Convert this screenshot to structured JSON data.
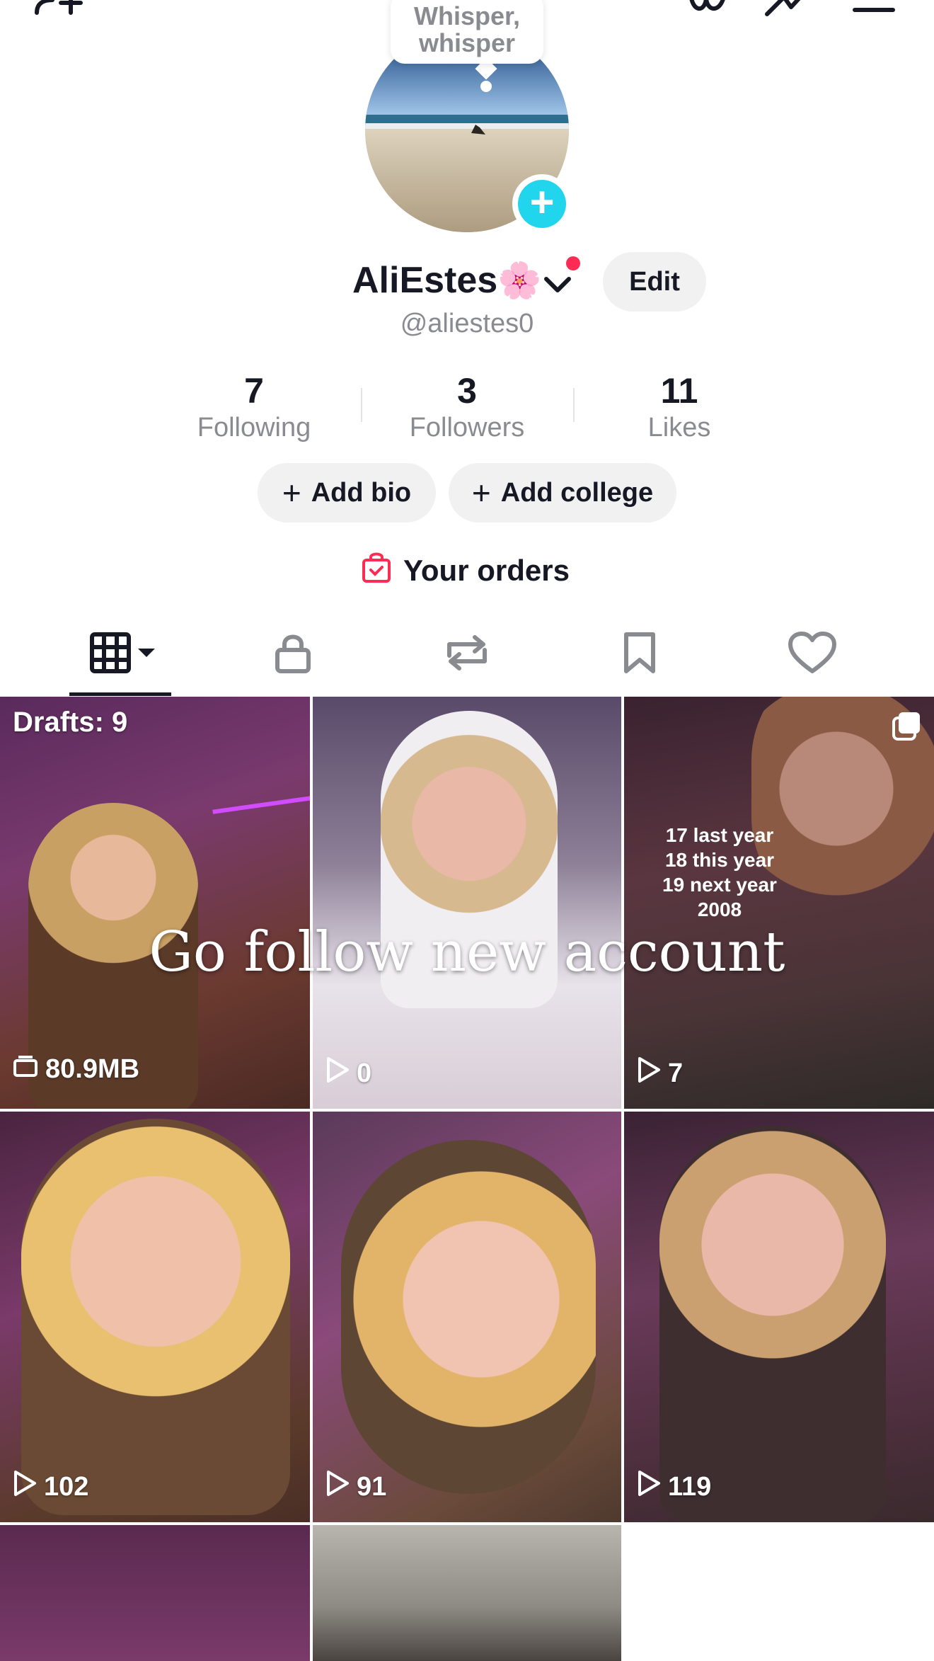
{
  "bubble": {
    "line1": "Whisper,",
    "line2": "whisper"
  },
  "profile": {
    "name": "AliEstes",
    "emoji": "🌸",
    "handle": "@aliestes0",
    "edit_label": "Edit"
  },
  "stats": [
    {
      "value": "7",
      "label": "Following"
    },
    {
      "value": "3",
      "label": "Followers"
    },
    {
      "value": "11",
      "label": "Likes"
    }
  ],
  "buttons": {
    "add_bio": "Add bio",
    "add_college": "Add college",
    "plus": "+"
  },
  "orders_label": "Your orders",
  "grid": {
    "drafts_label": "Drafts: 9",
    "drafts_size": "80.9MB",
    "overlay_text": "Go follow new account",
    "caption_lines": "17 last year\n18 this year\n19 next year\n2008",
    "views": [
      "0",
      "7",
      "102",
      "91",
      "119"
    ]
  },
  "colors": {
    "accent_blue": "#20d5ec",
    "notif_red": "#fe2c55",
    "pill_bg": "#f1f1f2"
  }
}
